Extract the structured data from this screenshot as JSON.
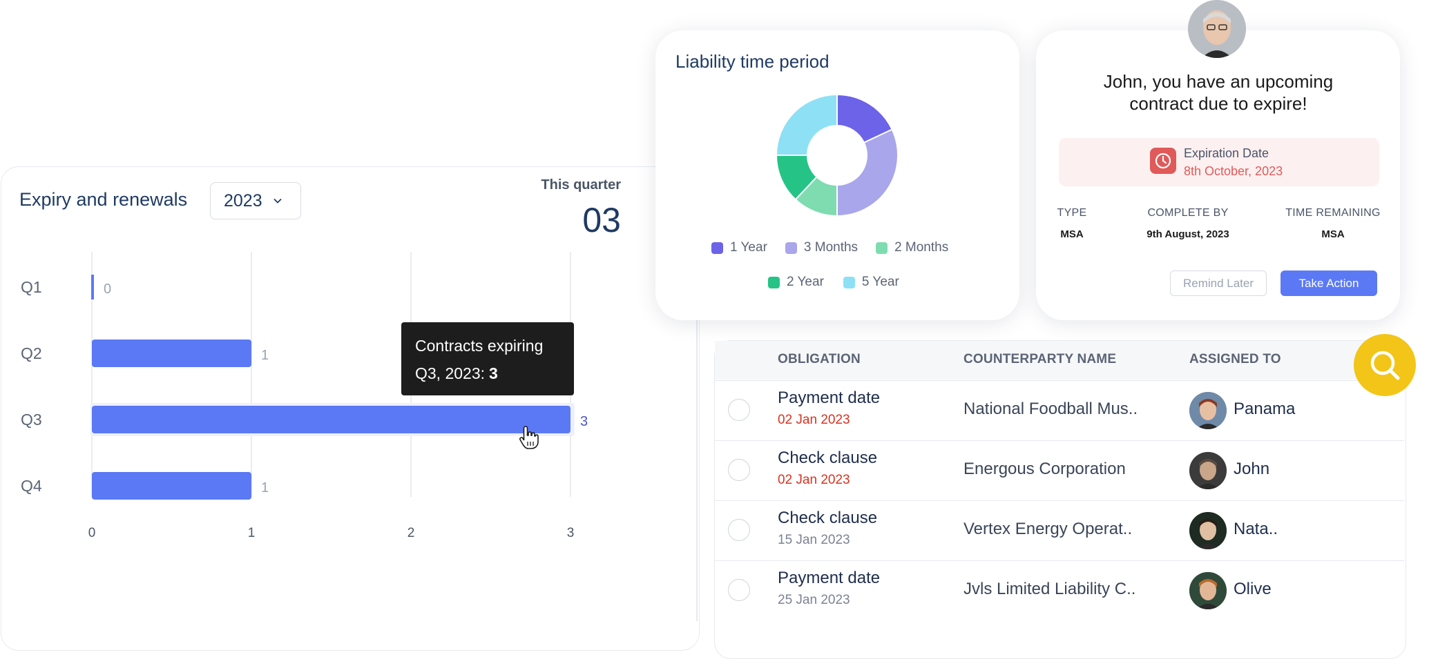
{
  "expiry": {
    "title": "Expiry and renewals",
    "year": "2023",
    "quarter_label": "This quarter",
    "quarter_value": "03",
    "tooltip_line1": "Contracts expiring",
    "tooltip_line2": "Q3, 2023:",
    "tooltip_value": "3"
  },
  "chart_data": {
    "type": "bar",
    "orientation": "horizontal",
    "categories": [
      "Q1",
      "Q2",
      "Q3",
      "Q4"
    ],
    "values": [
      0,
      1,
      3,
      1
    ],
    "x_ticks": [
      "0",
      "1",
      "2",
      "3"
    ],
    "xlim": [
      0,
      3
    ],
    "grid": true,
    "highlighted": "Q3",
    "color": "#5b79f5"
  },
  "liability": {
    "title": "Liability time period",
    "chart_data": {
      "type": "pie",
      "donut": true,
      "labels": [
        "1 Year",
        "3 Months",
        "2 Months",
        "2 Year",
        "5 Year"
      ],
      "values": [
        18,
        32,
        12,
        13,
        25
      ],
      "colors": [
        "#6c63e8",
        "#a9a6ec",
        "#7edcb0",
        "#25c486",
        "#8ee0f5"
      ]
    }
  },
  "notice": {
    "line1": "John, you have an upcoming",
    "line2": "contract due to expire!",
    "expire_label": "Expiration Date",
    "expire_date": "8th October, 2023",
    "meta": [
      {
        "header": "TYPE",
        "value": "MSA"
      },
      {
        "header": "COMPLETE BY",
        "value": "9th August, 2023"
      },
      {
        "header": "TIME REMAINING",
        "value": "MSA"
      }
    ],
    "remind_label": "Remind Later",
    "action_label": "Take Action"
  },
  "table": {
    "headers": [
      "OBLIGATION",
      "COUNTERPARTY NAME",
      "ASSIGNED TO"
    ],
    "rows": [
      {
        "title": "Payment date",
        "date": "02 Jan 2023",
        "date_color": "#d8321f",
        "counterparty": "National Foodball Mus..",
        "assignee": "Panama"
      },
      {
        "title": "Check clause",
        "date": "02 Jan 2023",
        "date_color": "#d8321f",
        "counterparty": "Energous Corporation",
        "assignee": "John"
      },
      {
        "title": "Check clause",
        "date": "15 Jan 2023",
        "date_color": "#7a8293",
        "counterparty": "Vertex Energy Operat..",
        "assignee": "Nata.."
      },
      {
        "title": "Payment date",
        "date": "25 Jan 2023",
        "date_color": "#7a8293",
        "counterparty": "Jvls Limited Liability C..",
        "assignee": "Olive"
      }
    ]
  }
}
